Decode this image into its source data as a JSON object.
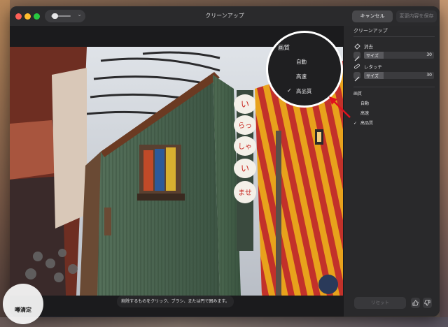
{
  "window": {
    "title": "クリーンアップ",
    "cancel_label": "キャンセル",
    "save_label": "変更内容を保存"
  },
  "photo": {
    "hint": "削除するものをクリック、ブラシ、または円で囲みます。"
  },
  "panel": {
    "title": "クリーンアップ",
    "erase": {
      "label": "消去",
      "size_label": "サイズ",
      "size_value": "30",
      "icon": "eraser-icon"
    },
    "retouch": {
      "label": "レタッチ",
      "size_label": "サイズ",
      "size_value": "30",
      "icon": "bandage-icon"
    },
    "quality": {
      "title": "画質",
      "options": [
        {
          "label": "自動",
          "checked": false
        },
        {
          "label": "高速",
          "checked": false
        },
        {
          "label": "高品質",
          "checked": true
        }
      ]
    },
    "reset_label": "リセット"
  },
  "callout": {
    "title": "画質",
    "options": [
      {
        "label": "自動",
        "checked": false
      },
      {
        "label": "高速",
        "checked": false
      },
      {
        "label": "高品質",
        "checked": true
      }
    ],
    "check_mark": "✓"
  },
  "sign": {
    "chars": [
      "い",
      "らっ",
      "しゃ",
      "い",
      "ませ"
    ]
  },
  "watermark": {
    "text": "噂清定"
  },
  "colors": {
    "accent_arrow": "#e0121e",
    "panel_bg": "#29292b"
  }
}
